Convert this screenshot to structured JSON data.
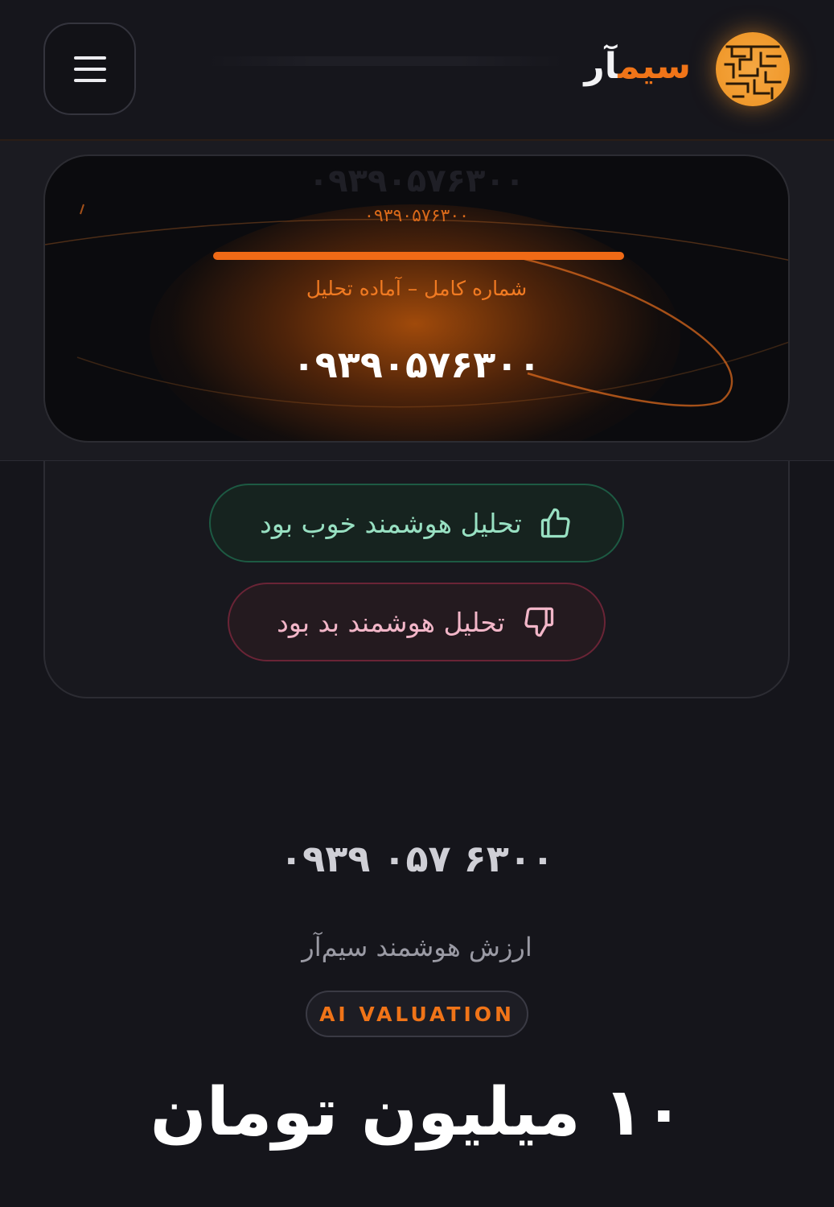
{
  "header": {
    "brand_accent": "سیم",
    "brand_rest": "آر",
    "menu_icon": "hamburger-menu-icon",
    "logo_icon": "maze-logo-icon"
  },
  "phone_card": {
    "ghost_number": "۰۹۳۹۰۵۷۶۳۰۰",
    "small_digits": "۰۹۳۹۰۵۷۶۳۰۰",
    "progress_percent": 100,
    "status_text": "شماره کامل – آماده تحلیل",
    "number": "۰۹۳۹۰۵۷۶۳۰۰"
  },
  "feedback": {
    "good_label": "تحلیل هوشمند خوب بود",
    "good_icon": "thumbs-up-icon",
    "bad_label": "تحلیل هوشمند بد بود",
    "bad_icon": "thumbs-down-icon"
  },
  "valuation": {
    "number": "۰۹۳۹ ۰۵۷ ۶۳۰۰",
    "caption": "ارزش هوشمند سیم‌آر",
    "badge": "AI VALUATION",
    "amount": "۱۰ میلیون تومان"
  },
  "colors": {
    "accent": "#f07418",
    "background": "#15151b",
    "good": "#98e0c2",
    "bad": "#f2b6c8"
  }
}
